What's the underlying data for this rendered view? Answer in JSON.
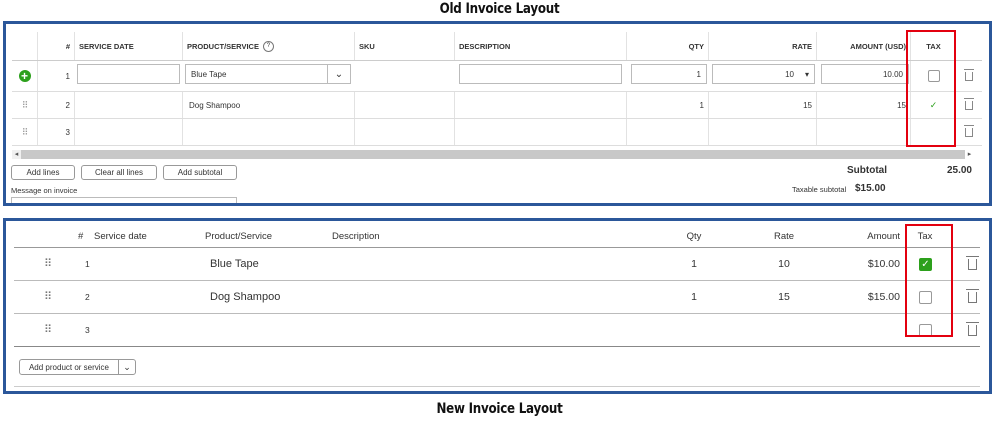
{
  "captions": {
    "old": "Old Invoice Layout",
    "new": "New Invoice Layout"
  },
  "old_invoice": {
    "headers": {
      "num": "#",
      "service_date": "SERVICE DATE",
      "product": "PRODUCT/SERVICE",
      "sku": "SKU",
      "description": "DESCRIPTION",
      "qty": "QTY",
      "rate": "RATE",
      "amount": "AMOUNT (USD)",
      "tax": "TAX"
    },
    "rows": [
      {
        "num": "1",
        "product": "Blue Tape",
        "qty": "1",
        "rate": "10",
        "amount": "10.00",
        "taxed": false
      },
      {
        "num": "2",
        "product": "Dog Shampoo",
        "qty": "1",
        "rate": "15",
        "amount": "15",
        "taxed": true
      },
      {
        "num": "3",
        "product": "",
        "qty": "",
        "rate": "",
        "amount": "",
        "taxed": false
      }
    ],
    "buttons": {
      "add_lines": "Add lines",
      "clear_all": "Clear all lines",
      "add_subtotal": "Add subtotal"
    },
    "message_label": "Message on invoice",
    "subtotal_label": "Subtotal",
    "subtotal_value": "25.00",
    "taxable_label": "Taxable subtotal",
    "taxable_value": "$15.00",
    "check_mark": "✓",
    "rate_dropdown": "▾"
  },
  "new_invoice": {
    "headers": {
      "num": "#",
      "service_date": "Service date",
      "product": "Product/Service",
      "description": "Description",
      "qty": "Qty",
      "rate": "Rate",
      "amount": "Amount",
      "tax": "Tax"
    },
    "rows": [
      {
        "num": "1",
        "product": "Blue Tape",
        "qty": "1",
        "rate": "10",
        "amount": "$10.00",
        "taxed": true
      },
      {
        "num": "2",
        "product": "Dog Shampoo",
        "qty": "1",
        "rate": "15",
        "amount": "$15.00",
        "taxed": false
      },
      {
        "num": "3",
        "product": "",
        "qty": "",
        "rate": "",
        "amount": "",
        "taxed": false
      }
    ],
    "add_button": "Add product or service",
    "check_mark": "✓"
  },
  "colors": {
    "frame": "#2b579a",
    "highlight": "#e3000f",
    "accent": "#2ca01c"
  }
}
